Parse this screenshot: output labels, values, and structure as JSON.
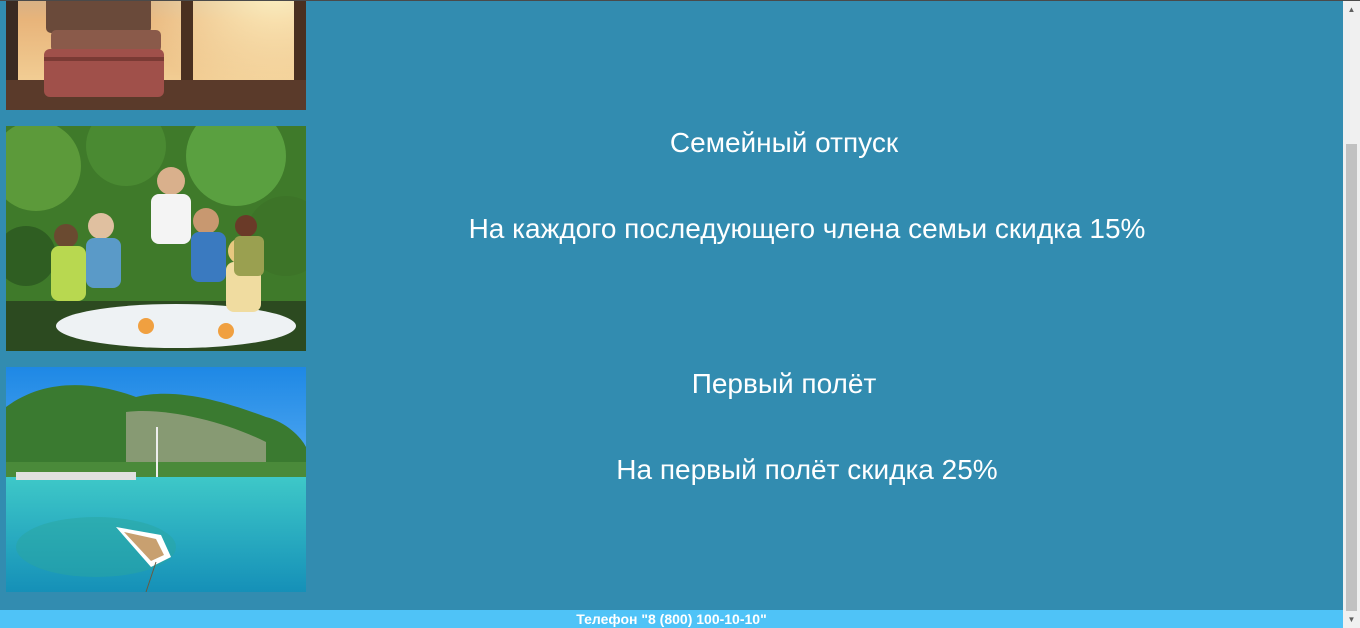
{
  "offers": [
    {
      "image": "suitcases-photo",
      "title": "",
      "description": ""
    },
    {
      "image": "family-dinner-photo",
      "title": "Семейный отпуск",
      "description": "На каждого последующего члена семьи скидка 15%"
    },
    {
      "image": "island-bay-photo",
      "title": "Первый полёт",
      "description": "На первый полёт скидка 25%"
    }
  ],
  "footer": {
    "phone_text": "Телефон \"8 (800) 100-10-10\""
  },
  "colors": {
    "background": "#328cb0",
    "footer": "#4fc3f7",
    "text": "#ffffff"
  }
}
